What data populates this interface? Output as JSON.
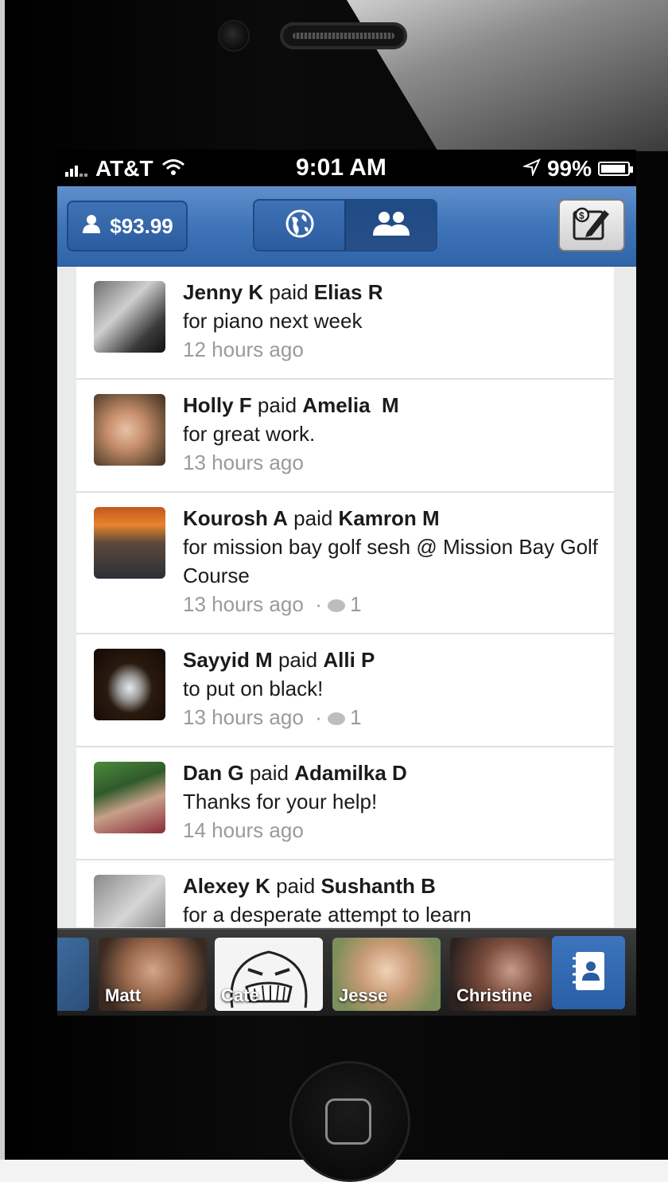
{
  "status_bar": {
    "carrier": "AT&T",
    "time": "9:01 AM",
    "battery": "99%"
  },
  "nav": {
    "balance": "$93.99",
    "tabs": [
      "public-feed",
      "friends-feed"
    ],
    "active_tab": "friends-feed"
  },
  "feed": [
    {
      "from": "Jenny K",
      "verb": "paid",
      "to": "Elias R",
      "note": "for piano next week",
      "time": "12 hours ago",
      "comments": ""
    },
    {
      "from": "Holly F",
      "verb": "paid",
      "to": "Amelia  M",
      "note": "for great work.",
      "time": "13 hours ago",
      "comments": ""
    },
    {
      "from": "Kourosh A",
      "verb": "paid",
      "to": "Kamron M",
      "note": "for mission bay golf sesh @ Mission Bay Golf Course",
      "time": "13 hours ago",
      "comments": "1"
    },
    {
      "from": "Sayyid M",
      "verb": "paid",
      "to": "Alli P",
      "note": "to put on black!",
      "time": "13 hours ago",
      "comments": "1"
    },
    {
      "from": "Dan G",
      "verb": "paid",
      "to": "Adamilka D",
      "note": "Thanks for your help!",
      "time": "14 hours ago",
      "comments": ""
    },
    {
      "from": "Alexey K",
      "verb": "paid",
      "to": "Sushanth B",
      "note": "for a desperate attempt to learn",
      "time": "",
      "comments": ""
    }
  ],
  "friends_bar": {
    "friends": [
      "Matt",
      "Cate",
      "Jesse",
      "Christine"
    ]
  },
  "colors": {
    "nav_blue": "#3f74b8",
    "meta_gray": "#9a9a9a"
  }
}
